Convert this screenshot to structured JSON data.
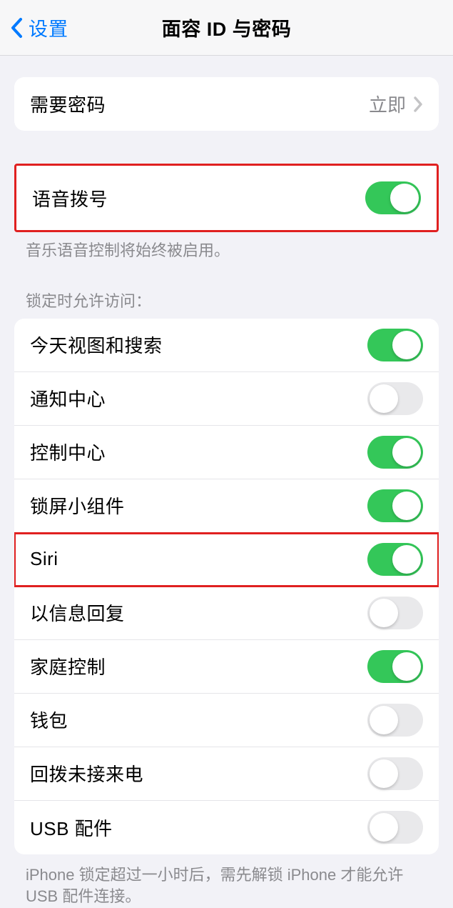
{
  "nav": {
    "back_label": "设置",
    "title": "面容 ID 与密码"
  },
  "group_require": {
    "label": "需要密码",
    "value": "立即"
  },
  "group_voice": {
    "label": "语音拨号",
    "on": true,
    "footer": "音乐语音控制将始终被启用。"
  },
  "lock_access": {
    "header": "锁定时允许访问：",
    "items": [
      {
        "label": "今天视图和搜索",
        "on": true
      },
      {
        "label": "通知中心",
        "on": false
      },
      {
        "label": "控制中心",
        "on": true
      },
      {
        "label": "锁屏小组件",
        "on": true
      },
      {
        "label": "Siri",
        "on": true,
        "highlighted": true
      },
      {
        "label": "以信息回复",
        "on": false
      },
      {
        "label": "家庭控制",
        "on": true
      },
      {
        "label": "钱包",
        "on": false
      },
      {
        "label": "回拨未接来电",
        "on": false
      },
      {
        "label": "USB 配件",
        "on": false
      }
    ],
    "footer": "iPhone 锁定超过一小时后，需先解锁 iPhone 才能允许USB 配件连接。"
  }
}
